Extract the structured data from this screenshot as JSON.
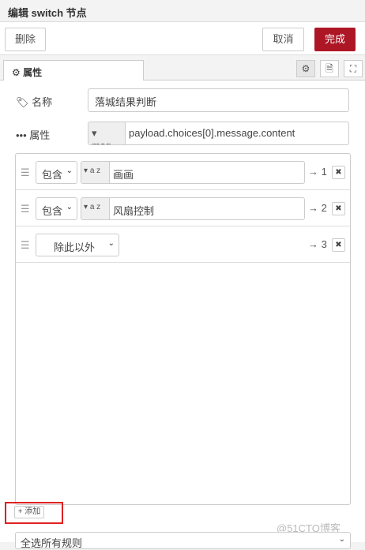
{
  "header": {
    "title": "编辑 switch 节点"
  },
  "toolbar": {
    "delete_label": "删除",
    "cancel_label": "取消",
    "done_label": "完成"
  },
  "tabs": {
    "properties_label": "属性",
    "icons": [
      "gear-icon",
      "document-icon",
      "frame-icon"
    ]
  },
  "form": {
    "name_label": "名称",
    "name_value": "落城结果判断",
    "property_label": "属性",
    "property_type": "msg.",
    "property_value": "payload.choices[0].message.content"
  },
  "rules": [
    {
      "op": "包含",
      "type": "a z",
      "value": "画画",
      "output": "→ 1"
    },
    {
      "op": "包含",
      "type": "a z",
      "value": "风扇控制",
      "output": "→ 2"
    },
    {
      "op": "除此以外",
      "output": "→ 3"
    }
  ],
  "add_label": "+ 添加",
  "bottom_select": {
    "value": "全选所有规则"
  },
  "watermark": "@51CTO博客",
  "colors": {
    "accent": "#ad1625",
    "highlight": "#e02020"
  }
}
